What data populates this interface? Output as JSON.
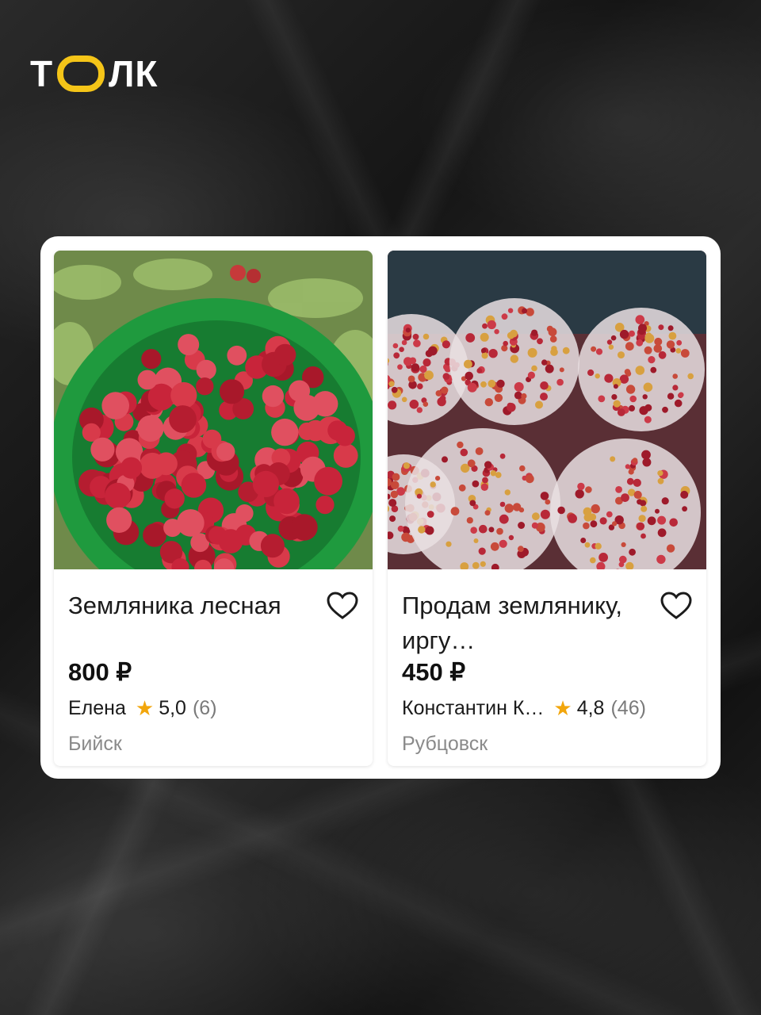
{
  "brand": {
    "logo_text_left": "Т",
    "logo_text_right": "ЛК",
    "accent_color": "#f5c518"
  },
  "listings": [
    {
      "title": "Земляника лесная",
      "price": "800 ₽",
      "seller": "Елена",
      "rating": "5,0",
      "reviews": "(6)",
      "city": "Бийск",
      "photo_icon": "strawberries-green-bucket-photo",
      "favorite_icon": "heart-outline-icon"
    },
    {
      "title": "Продам землянику, иргу…",
      "price": "450 ₽",
      "seller": "Константин К…",
      "rating": "4,8",
      "reviews": "(46)",
      "city": "Рубцовск",
      "photo_icon": "strawberry-buckets-photo",
      "favorite_icon": "heart-outline-icon"
    }
  ],
  "colors": {
    "star": "#f2a60c",
    "muted_text": "#8a8a8a"
  }
}
